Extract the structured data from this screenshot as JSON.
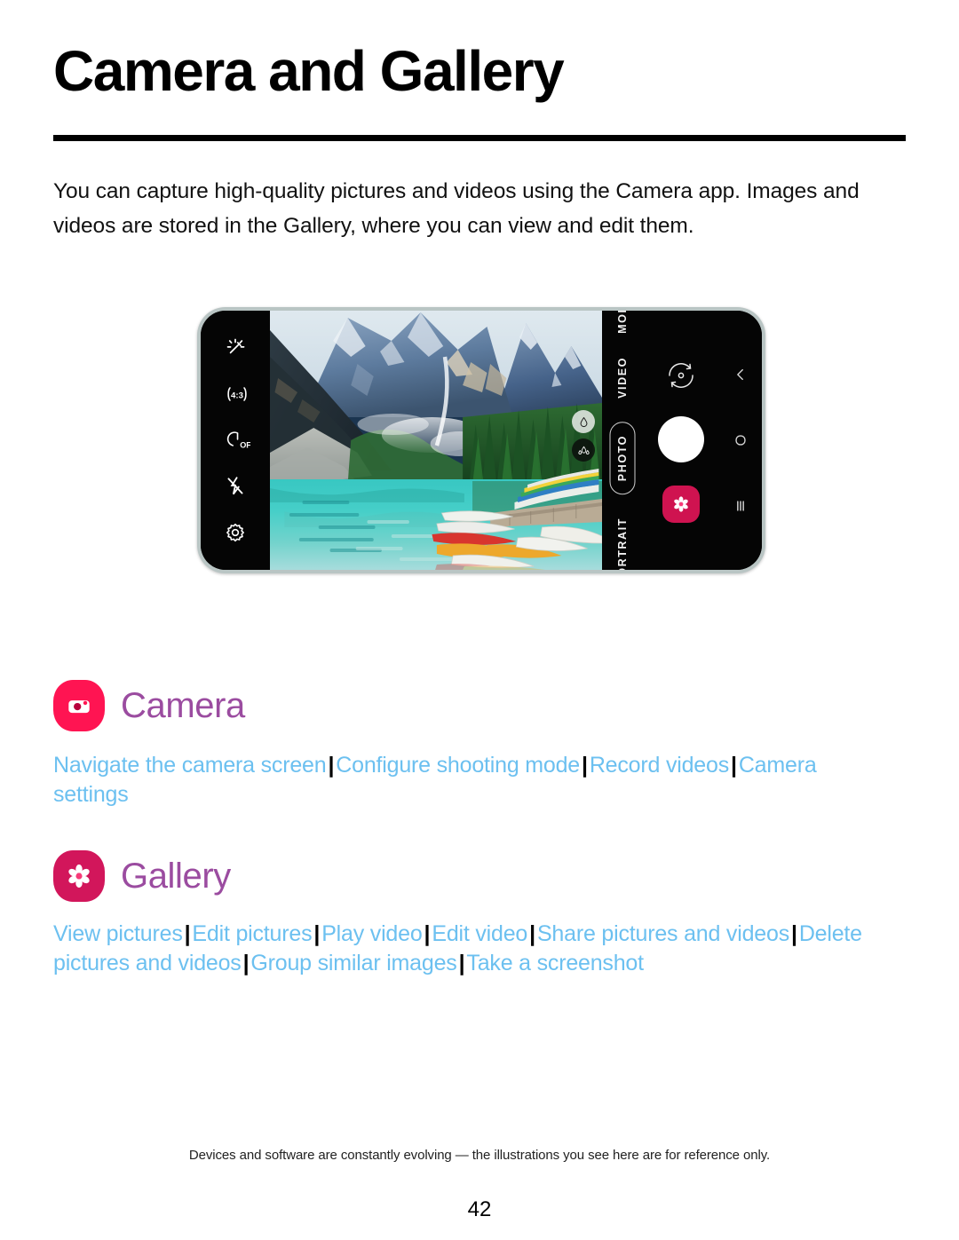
{
  "document": {
    "title": "Camera and Gallery",
    "intro": "You can capture high-quality pictures and videos using the Camera app. Images and videos are stored in the Gallery, where you can view and edit them.",
    "footer_note": "Devices and software are constantly evolving — the illustrations you see here are for reference only.",
    "page_number": "42"
  },
  "illustration": {
    "caption_alt": "Phone in landscape showing the Camera app viewfinder with a mountain lake and canoes",
    "camera_ui": {
      "left_toolbar": [
        {
          "id": "effects",
          "icon": "sparkle-effects-icon",
          "label": "Effects"
        },
        {
          "id": "aspect-ratio",
          "icon": "aspect-ratio-icon",
          "label": "4:3"
        },
        {
          "id": "timer",
          "icon": "timer-icon",
          "label": "OFF"
        },
        {
          "id": "flash",
          "icon": "flash-off-icon",
          "label": "Flash off"
        },
        {
          "id": "settings",
          "icon": "gear-icon",
          "label": "Settings"
        }
      ],
      "zoom_buttons": [
        {
          "id": "zoom-1x",
          "icon": "lens-wide-icon",
          "state": "active"
        },
        {
          "id": "zoom-ultrawide",
          "icon": "lens-ultrawide-icon",
          "state": "inactive"
        }
      ],
      "modes": [
        {
          "label": "MORE",
          "selected": false
        },
        {
          "label": "VIDEO",
          "selected": false
        },
        {
          "label": "PHOTO",
          "selected": true
        },
        {
          "label": "PORTRAIT",
          "selected": false
        }
      ],
      "controls": {
        "flip": "camera-flip-icon",
        "shutter": "shutter-button",
        "gallery_thumbnail": "gallery-thumbnail-button"
      },
      "navbar": [
        {
          "id": "back",
          "icon": "back-chevron-icon"
        },
        {
          "id": "home",
          "icon": "home-squircle-icon"
        },
        {
          "id": "recents",
          "icon": "recents-bars-icon"
        }
      ]
    }
  },
  "sections": [
    {
      "id": "camera",
      "app_name": "Camera",
      "icon": "camera-app-icon",
      "icon_color": "#ff1452",
      "links": [
        "Navigate the camera screen",
        "Configure shooting mode",
        "Record videos",
        "Camera settings"
      ]
    },
    {
      "id": "gallery",
      "app_name": "Gallery",
      "icon": "gallery-app-icon",
      "icon_color": "#d2165b",
      "links": [
        "View pictures",
        "Edit pictures",
        "Play video",
        "Edit video",
        "Share pictures and videos",
        "Delete pictures and videos",
        "Group similar images",
        "Take a screenshot"
      ]
    }
  ],
  "colors": {
    "link_blue": "#6cc0f0",
    "heading_purple": "#9b4ca0",
    "camera_pink": "#ff1452",
    "gallery_crimson": "#d2165b",
    "rule_black": "#000000"
  }
}
